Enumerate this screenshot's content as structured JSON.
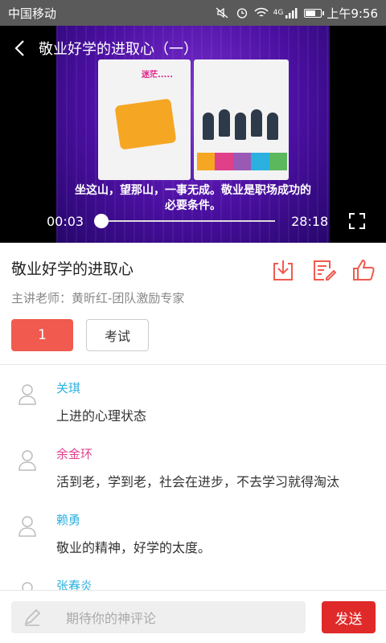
{
  "status_bar": {
    "carrier": "中国移动",
    "network": "4G",
    "time": "上午9:56",
    "battery_level": 0.6
  },
  "video": {
    "title": "敬业好学的进取心（一）",
    "slide_badge": "迷茫.....",
    "caption_line1": "坐这山，望那山，一事无成。敬业是职场成功的",
    "caption_line2": "必要条件。",
    "current_time": "00:03",
    "total_time": "28:18",
    "progress": 0.002
  },
  "course": {
    "title": "敬业好学的进取心",
    "teacher": "主讲老师：黄昕红-团队激励专家",
    "tab_active_label": "1",
    "tab_exam_label": "考试"
  },
  "comments": [
    {
      "name": "关琪",
      "text": "上进的心理状态",
      "name_color": "#2bb0e0"
    },
    {
      "name": "余金环",
      "text": "活到老，学到老，社会在进步，不去学习就得淘汰",
      "name_color": "#e0408a"
    },
    {
      "name": "赖勇",
      "text": "敬业的精神，好学的太度。",
      "name_color": "#2bb0e0"
    },
    {
      "name": "张春炎",
      "text": "",
      "name_color": "#2bb0e0"
    }
  ],
  "comment_bar": {
    "placeholder": "期待你的神评论",
    "send_label": "发送"
  },
  "colors": {
    "accent": "#f05a4f",
    "send": "#e02a2a"
  }
}
